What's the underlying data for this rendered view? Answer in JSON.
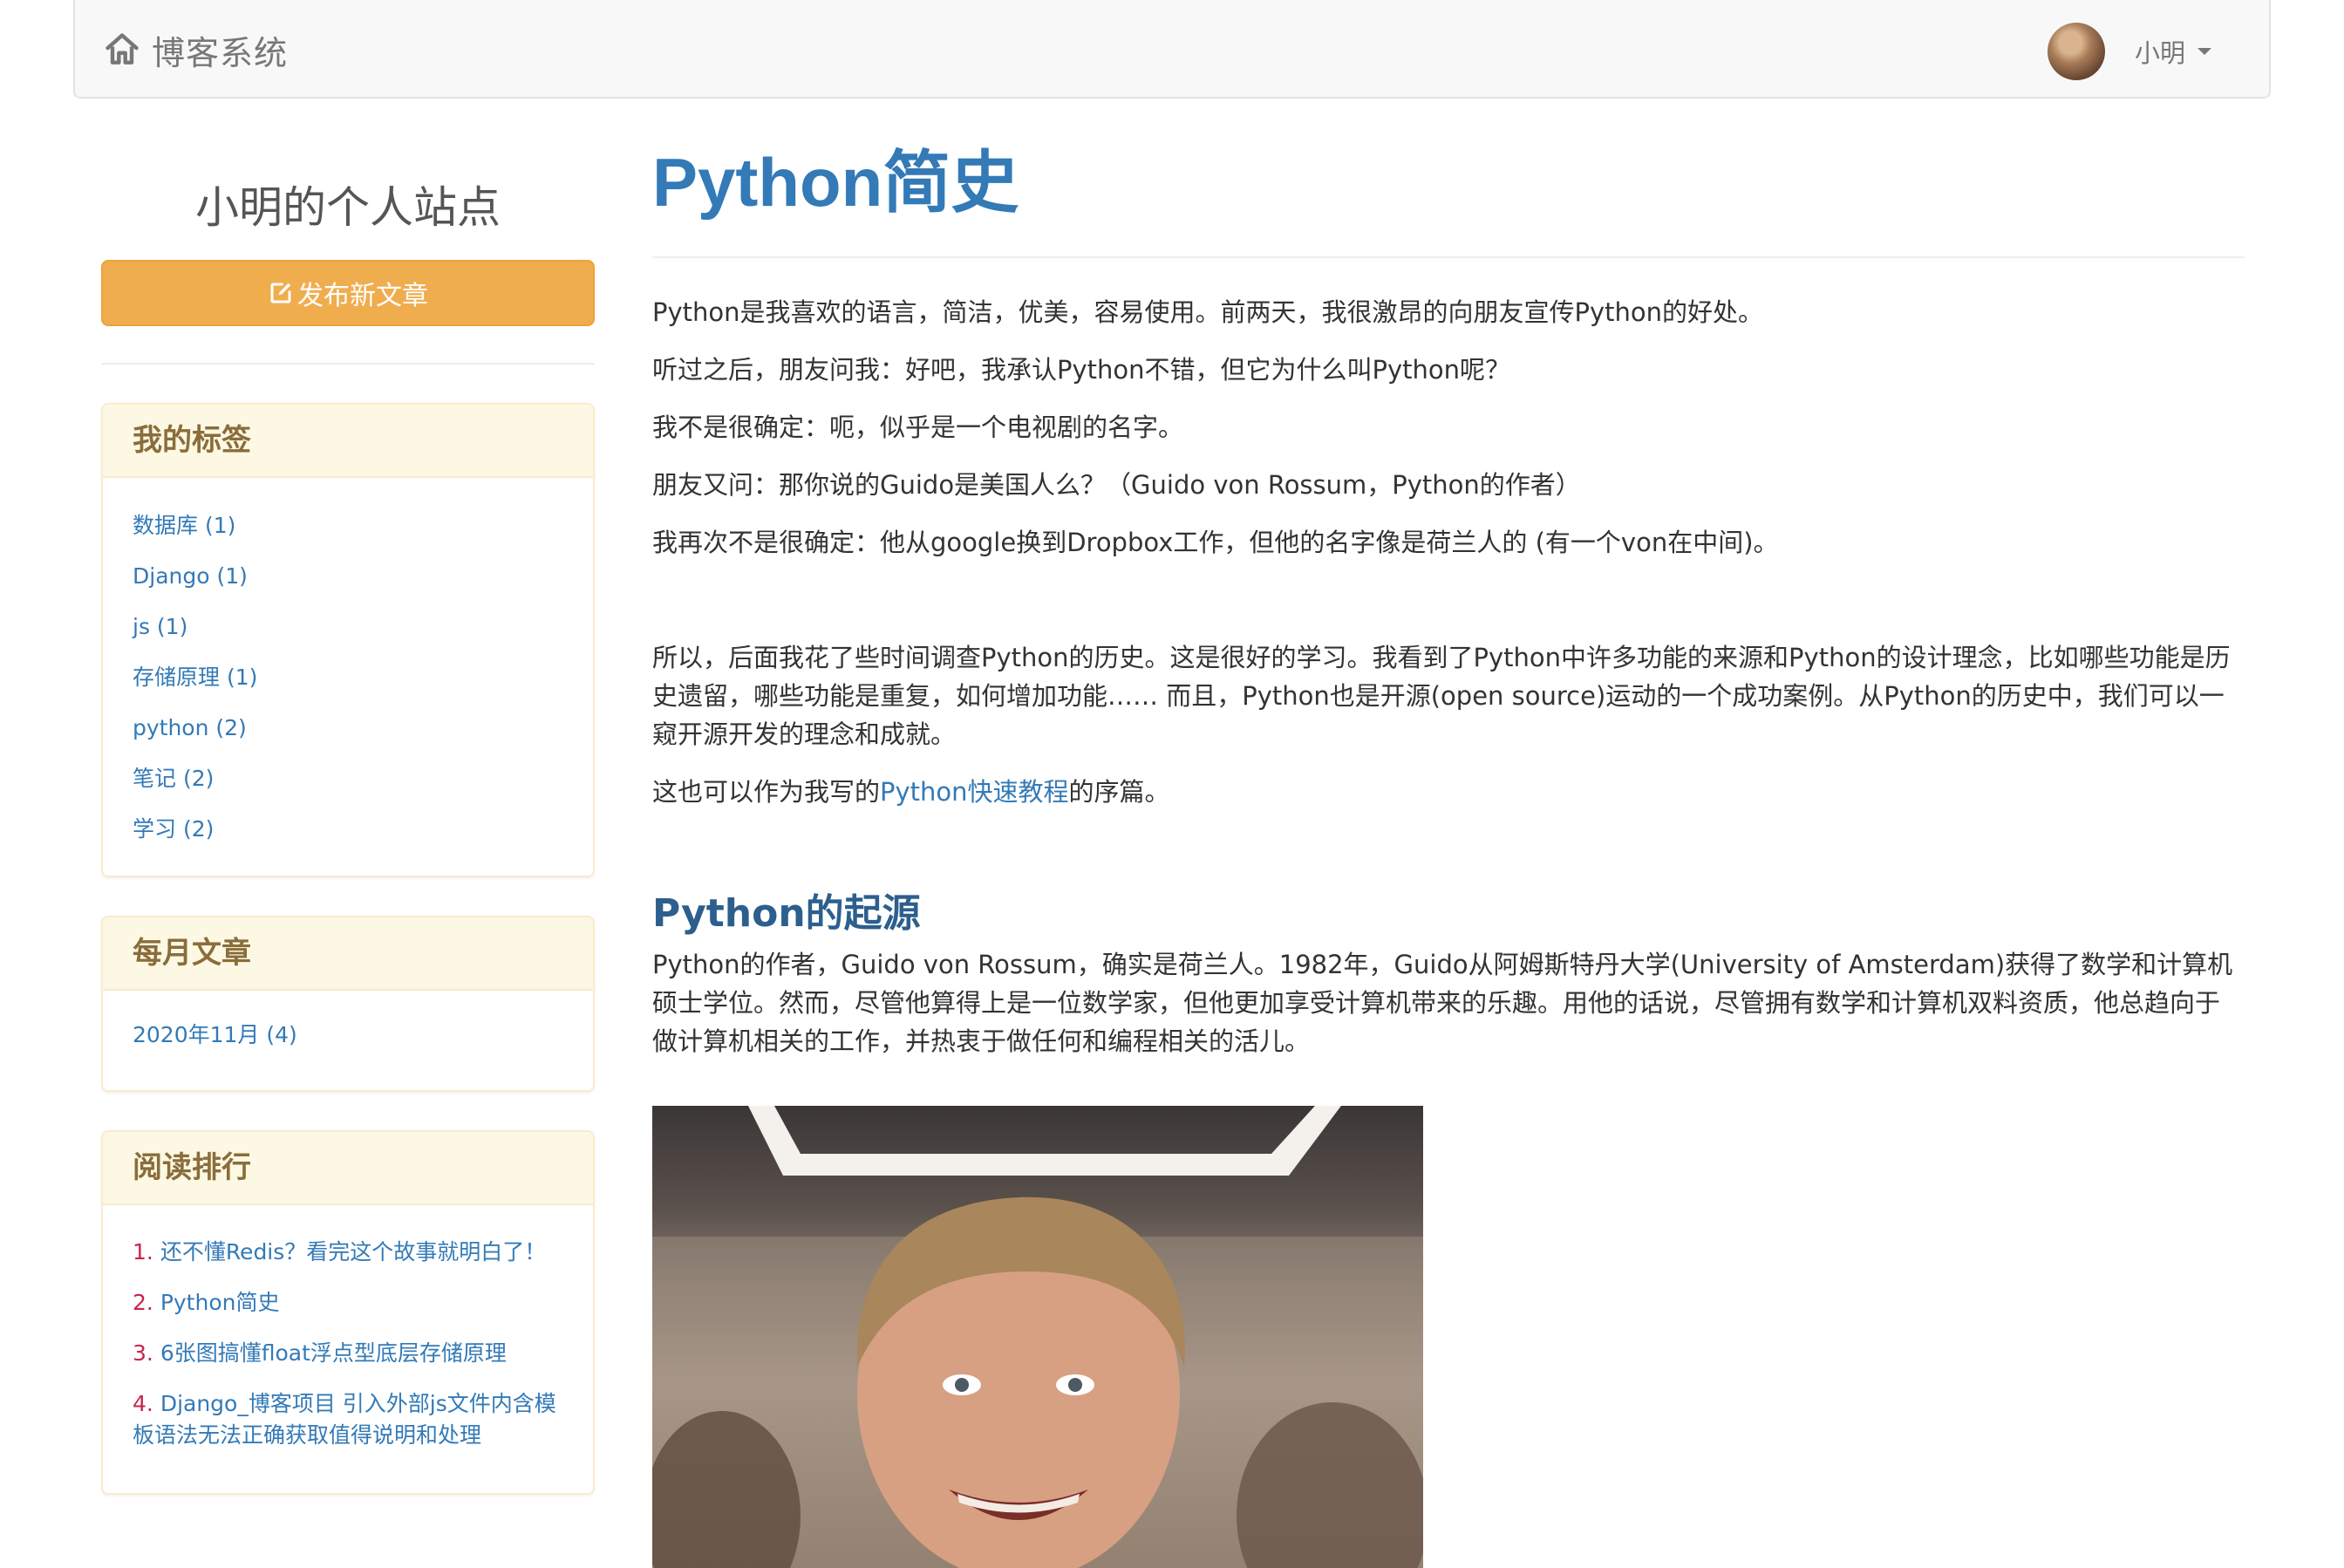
{
  "navbar": {
    "brand": "博客系统",
    "brand_icon": "home-icon",
    "user_name": "小明"
  },
  "sidebar": {
    "site_title": "小明的个人站点",
    "publish_button": "发布新文章",
    "publish_icon": "edit-icon",
    "tags": {
      "heading": "我的标签",
      "items": [
        "数据库 (1)",
        "Django (1)",
        "js (1)",
        "存储原理 (1)",
        "python (2)",
        "笔记 (2)",
        "学习 (2)"
      ]
    },
    "archive": {
      "heading": "每月文章",
      "items": [
        "2020年11月 (4)"
      ]
    },
    "ranking": {
      "heading": "阅读排行",
      "items": [
        {
          "num": "1.",
          "title": "还不懂Redis？看完这个故事就明白了！"
        },
        {
          "num": "2.",
          "title": "Python简史"
        },
        {
          "num": "3.",
          "title": "6张图搞懂float浮点型底层存储原理"
        },
        {
          "num": "4.",
          "title": "Django_博客项目 引入外部js文件内含模板语法无法正确获取值得说明和处理"
        }
      ]
    }
  },
  "article": {
    "title": "Python简史",
    "paragraphs": [
      "Python是我喜欢的语言，简洁，优美，容易使用。前两天，我很激昂的向朋友宣传Python的好处。",
      "听过之后，朋友问我：好吧，我承认Python不错，但它为什么叫Python呢？",
      "我不是很确定：呃，似乎是一个电视剧的名字。",
      "朋友又问：那你说的Guido是美国人么？（Guido von Rossum，Python的作者）",
      "我再次不是很确定：他从google换到Dropbox工作，但他的名字像是荷兰人的 (有一个von在中间)。"
    ],
    "paragraph_history": "所以，后面我花了些时间调查Python的历史。这是很好的学习。我看到了Python中许多功能的来源和Python的设计理念，比如哪些功能是历史遗留，哪些功能是重复，如何增加功能…… 而且，Python也是开源(open source)运动的一个成功案例。从Python的历史中，我们可以一窥开源开发的理念和成就。",
    "preface": {
      "before": "这也可以作为我写的",
      "link": "Python快速教程",
      "after": "的序篇。"
    },
    "section_title": "Python的起源",
    "section_paragraph": "Python的作者，Guido von Rossum，确实是荷兰人。1982年，Guido从阿姆斯特丹大学(University of Amsterdam)获得了数学和计算机硕士学位。然而，尽管他算得上是一位数学家，但他更加享受计算机带来的乐趣。用他的话说，尽管拥有数学和计算机双料资质，他总趋向于做计算机相关的工作，并热衷于做任何和编程相关的活儿。"
  }
}
